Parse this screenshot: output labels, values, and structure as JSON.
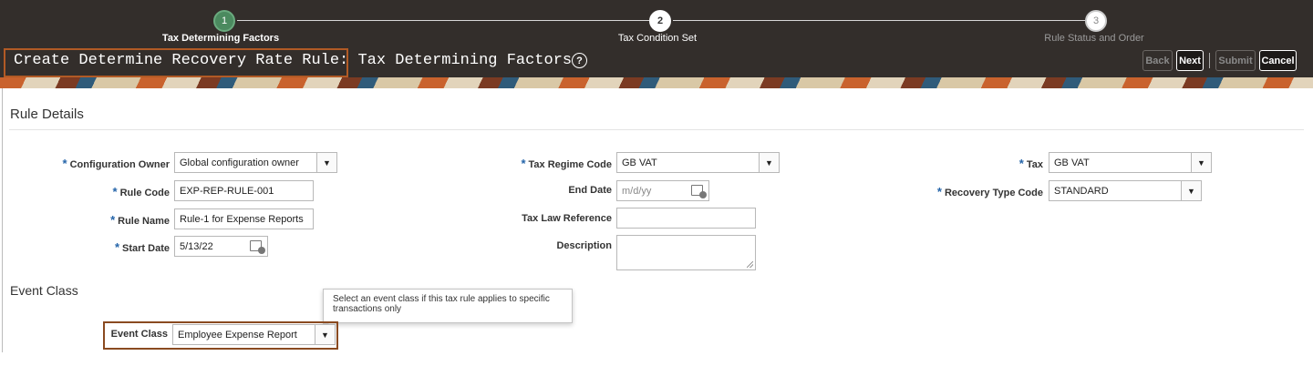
{
  "train": {
    "steps": [
      {
        "number": "1",
        "label": "Tax Determining Factors"
      },
      {
        "number": "2",
        "label": "Tax Condition Set"
      },
      {
        "number": "3",
        "label": "Rule Status and Order"
      }
    ]
  },
  "header": {
    "title": "Create Determine Recovery Rate Rule: Tax Determining Factors",
    "help_icon": "question-circle-icon",
    "back_label": "Back",
    "next_label": "Next",
    "submit_label": "Submit",
    "cancel_label": "Cancel"
  },
  "rule_details": {
    "title": "Rule Details",
    "configuration_owner": {
      "label": "Configuration Owner",
      "value": "Global configuration owner"
    },
    "rule_code": {
      "label": "Rule Code",
      "value": "EXP-REP-RULE-001"
    },
    "rule_name": {
      "label": "Rule Name",
      "value": "Rule-1 for Expense Reports"
    },
    "start_date": {
      "label": "Start Date",
      "value": "5/13/22"
    },
    "tax_regime_code": {
      "label": "Tax Regime Code",
      "value": "GB VAT"
    },
    "end_date": {
      "label": "End Date",
      "placeholder": "m/d/yy"
    },
    "tax_law_reference": {
      "label": "Tax Law Reference",
      "value": ""
    },
    "description": {
      "label": "Description",
      "value": ""
    },
    "tax": {
      "label": "Tax",
      "value": "GB VAT"
    },
    "recovery_type_code": {
      "label": "Recovery Type Code",
      "value": "STANDARD"
    },
    "required_marker": "*"
  },
  "event_class_section": {
    "title": "Event Class",
    "tooltip": "Select an event class if this tax rule applies to specific transactions only",
    "event_class": {
      "label": "Event Class",
      "value": "Employee Expense Report"
    }
  },
  "icons": {
    "dropdown": "dropdown-arrow-icon",
    "calendar": "calendar-icon"
  },
  "colors": {
    "header_bg": "#332e2b",
    "step_done": "#4b8a5f",
    "required": "#2464a9",
    "highlight": "#b15a25"
  }
}
